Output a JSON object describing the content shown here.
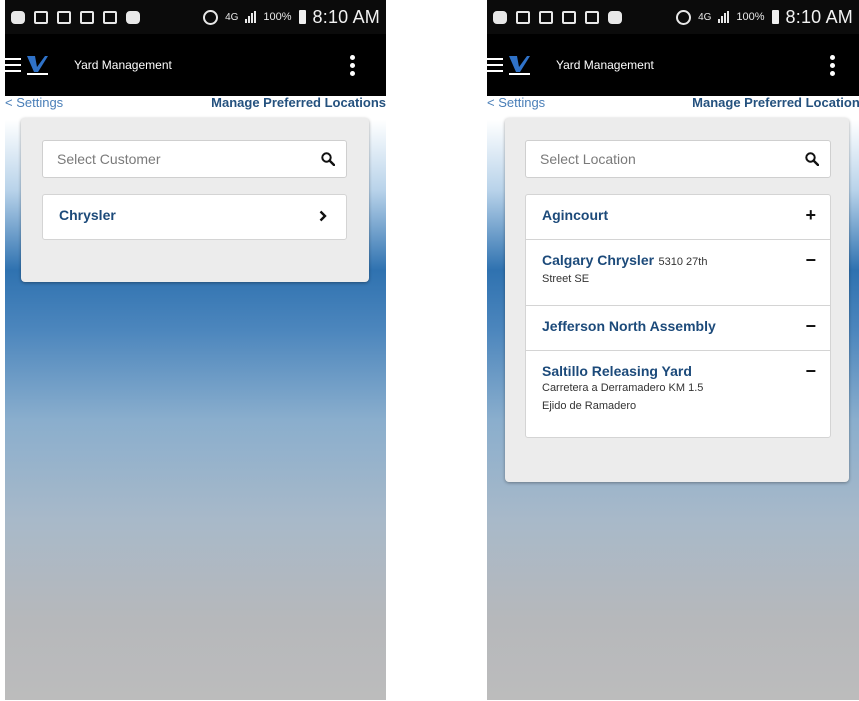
{
  "status_bar": {
    "battery": "100%",
    "time": "8:10 AM",
    "network": "4G"
  },
  "app_bar": {
    "title": "Yard Management"
  },
  "nav": {
    "back_label": "< Settings",
    "title": "Manage Preferred Locations"
  },
  "left_screen": {
    "search": {
      "placeholder": "Select Customer"
    },
    "items": [
      {
        "title": "Chrysler",
        "action_icon": "chevron-right-icon"
      }
    ]
  },
  "right_screen": {
    "search": {
      "placeholder": "Select Location"
    },
    "items": [
      {
        "title": "Agincourt",
        "action": "+",
        "action_icon": "plus-icon"
      },
      {
        "title": "Calgary Chrysler",
        "inline_sub": "5310 27th",
        "sub": [
          "Street SE"
        ],
        "action": "−",
        "action_icon": "minus-icon"
      },
      {
        "title": "Jefferson North Assembly",
        "action": "−",
        "action_icon": "minus-icon"
      },
      {
        "title": "Saltillo Releasing Yard",
        "sub": [
          "Carretera a Derramadero KM 1.5",
          "Ejido de Ramadero"
        ],
        "action": "−",
        "action_icon": "minus-icon"
      }
    ]
  },
  "colors": {
    "accent": "#1c4a7a",
    "link": "#4a7fb8",
    "appbar": "#000000",
    "gradient_blue": "#2f72b0"
  }
}
